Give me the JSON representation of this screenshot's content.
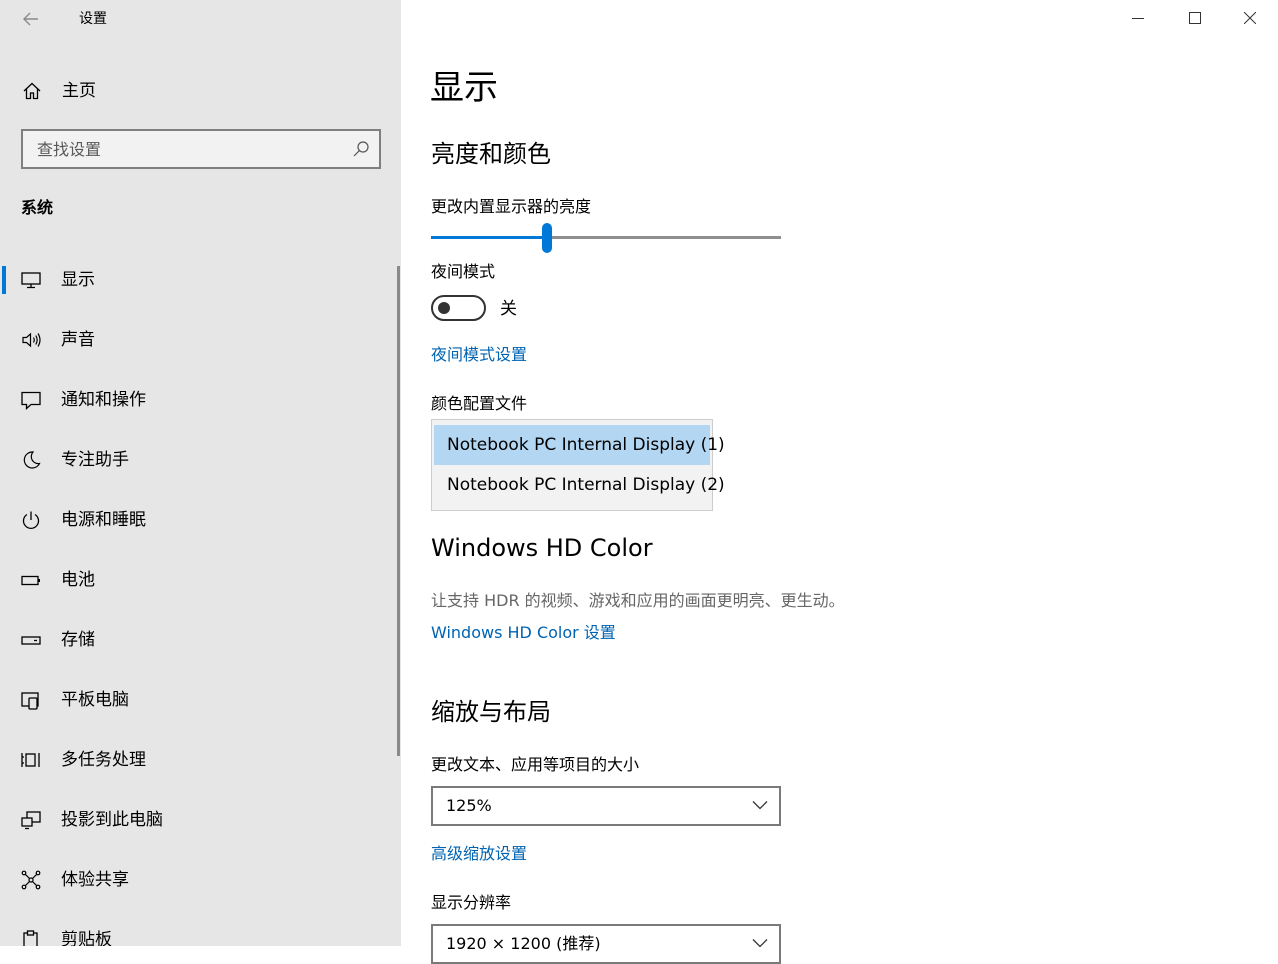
{
  "app": {
    "title": "设置"
  },
  "sidebar": {
    "home_label": "主页",
    "search_placeholder": "查找设置",
    "section_label": "系统",
    "items": [
      {
        "label": "显示",
        "icon": "monitor-icon",
        "selected": true
      },
      {
        "label": "声音",
        "icon": "speaker-icon"
      },
      {
        "label": "通知和操作",
        "icon": "notification-icon"
      },
      {
        "label": "专注助手",
        "icon": "moon-icon"
      },
      {
        "label": "电源和睡眠",
        "icon": "power-icon"
      },
      {
        "label": "电池",
        "icon": "battery-icon"
      },
      {
        "label": "存储",
        "icon": "storage-icon"
      },
      {
        "label": "平板电脑",
        "icon": "tablet-icon"
      },
      {
        "label": "多任务处理",
        "icon": "multitask-icon"
      },
      {
        "label": "投影到此电脑",
        "icon": "project-icon"
      },
      {
        "label": "体验共享",
        "icon": "share-icon"
      },
      {
        "label": "剪贴板",
        "icon": "clipboard-icon"
      }
    ]
  },
  "main": {
    "title": "显示",
    "brightness_section": {
      "heading": "亮度和颜色",
      "brightness_label": "更改内置显示器的亮度",
      "brightness_value": 0.33,
      "night_light_label": "夜间模式",
      "night_light_state": "关",
      "night_light_settings_link": "夜间模式设置",
      "color_profile_label": "颜色配置文件",
      "color_profile_options": [
        "Notebook PC Internal Display (1)",
        "Notebook PC Internal Display (2)"
      ]
    },
    "hdr_section": {
      "heading": "Windows HD Color",
      "description": "让支持 HDR 的视频、游戏和应用的画面更明亮、更生动。",
      "settings_link": "Windows HD Color 设置"
    },
    "scale_section": {
      "heading": "缩放与布局",
      "scale_label": "更改文本、应用等项目的大小",
      "scale_value": "125%",
      "advanced_link": "高级缩放设置",
      "resolution_label": "显示分辨率",
      "resolution_value": "1920 × 1200 (推荐)"
    }
  },
  "colors": {
    "accent": "#0078d7",
    "link": "#0063b1",
    "sidebar_bg": "#e6e6e6",
    "selection": "#b3d7f3"
  }
}
